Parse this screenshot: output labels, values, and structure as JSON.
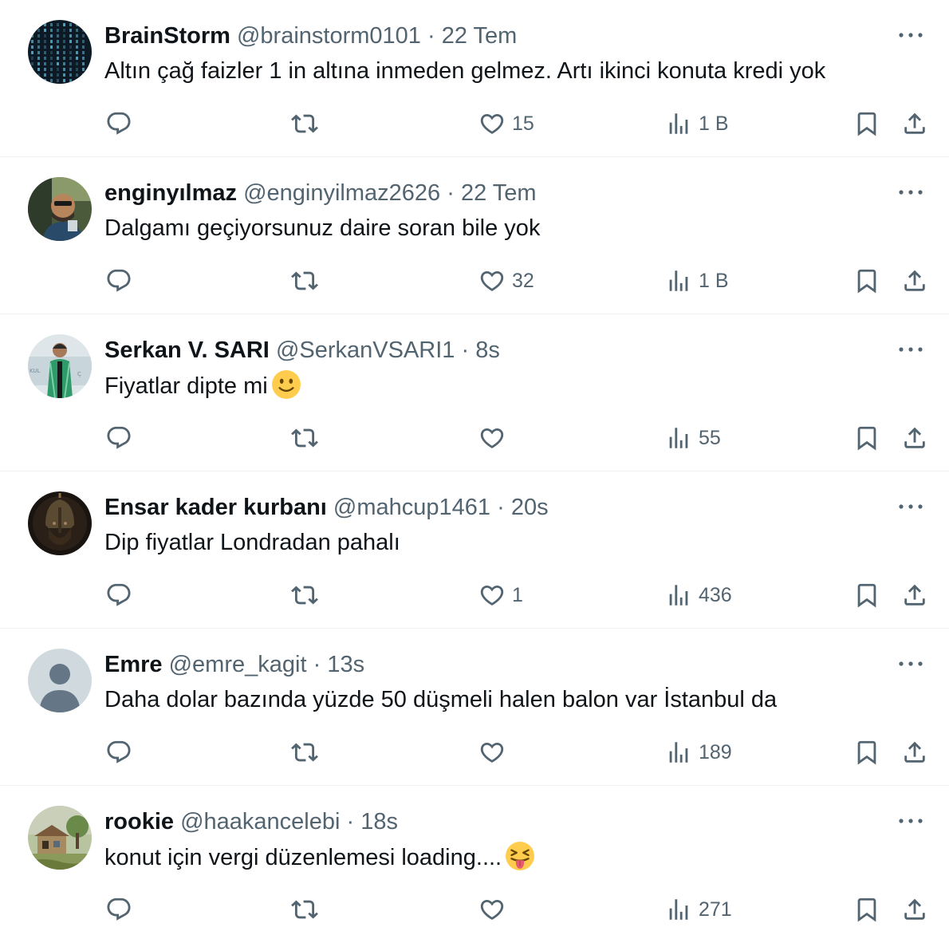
{
  "tweets": [
    {
      "name": "BrainStorm",
      "handle": "@brainstorm0101",
      "separator": "·",
      "time": "22 Tem",
      "text": "Altın çağ faizler 1 in altına inmeden gelmez. Artı ikinci konuta kredi yok",
      "emoji": "",
      "avatar": "matrix-code",
      "stats": {
        "replies": "",
        "retweets": "",
        "likes": "15",
        "views": "1 B"
      }
    },
    {
      "name": "enginyılmaz",
      "handle": "@enginyilmaz2626",
      "separator": "·",
      "time": "22 Tem",
      "text": "Dalgamı geçiyorsunuz daire soran bile yok",
      "emoji": "",
      "avatar": "man-in-car",
      "stats": {
        "replies": "",
        "retweets": "",
        "likes": "32",
        "views": "1 B"
      }
    },
    {
      "name": "Serkan V. SARI",
      "handle": "@SerkanVSARI1",
      "separator": "·",
      "time": "8s",
      "text": "Fiyatlar dipte mi",
      "emoji": "slightly-smiling-face",
      "avatar": "man-green-vest",
      "stats": {
        "replies": "",
        "retweets": "",
        "likes": "",
        "views": "55"
      }
    },
    {
      "name": "Ensar kader kurbanı",
      "handle": "@mahcup1461",
      "separator": "·",
      "time": "20s",
      "text": "Dip fiyatlar Londradan pahalı",
      "emoji": "",
      "avatar": "warrior-helmet",
      "stats": {
        "replies": "",
        "retweets": "",
        "likes": "1",
        "views": "436"
      }
    },
    {
      "name": "Emre",
      "handle": "@emre_kagit",
      "separator": "·",
      "time": "13s",
      "text": "Daha dolar bazında yüzde 50 düşmeli halen balon var İstanbul da",
      "emoji": "",
      "avatar": "default-profile",
      "stats": {
        "replies": "",
        "retweets": "",
        "likes": "",
        "views": "189"
      }
    },
    {
      "name": "rookie",
      "handle": "@haakancelebi",
      "separator": "·",
      "time": "18s",
      "text": "konut için vergi düzenlemesi loading....",
      "emoji": "squinting-face-with-tongue",
      "avatar": "house-painting",
      "stats": {
        "replies": "",
        "retweets": "",
        "likes": "",
        "views": "271"
      }
    }
  ],
  "colors": {
    "text_primary": "#0f1419",
    "text_secondary": "#536471",
    "divider": "#eff3f4"
  }
}
